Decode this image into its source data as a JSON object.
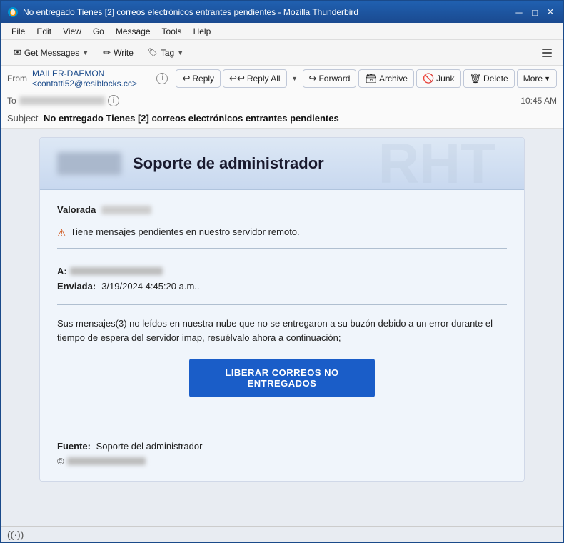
{
  "window": {
    "title": "No entregado Tienes [2] correos electrónicos entrantes pendientes - Mozilla Thunderbird",
    "title_short": "No entregado Tienes [2] correos electrónicos entrantes pendientes - Mozilla Thunderbird"
  },
  "menu": {
    "items": [
      "File",
      "Edit",
      "View",
      "Go",
      "Message",
      "Tools",
      "Help"
    ]
  },
  "toolbar": {
    "get_messages": "Get Messages",
    "write": "Write",
    "tag": "Tag",
    "hamburger_label": "≡"
  },
  "email_header": {
    "from_label": "From",
    "from_value": "MAILER-DAEMON <contatti52@resiblocks.cc>",
    "reply_label": "Reply",
    "reply_all_label": "Reply All",
    "forward_label": "Forward",
    "archive_label": "Archive",
    "junk_label": "Junk",
    "delete_label": "Delete",
    "more_label": "More",
    "to_label": "To",
    "time_value": "10:45 AM",
    "subject_label": "Subject",
    "subject_value": "No entregado Tienes [2] correos electrónicos entrantes pendientes"
  },
  "email_body": {
    "header_title": "Soporte de administrador",
    "valorada_label": "Valorada",
    "warning_text": "Tiene mensajes pendientes en nuestro servidor remoto.",
    "to_label": "A:",
    "sent_label": "Enviada:",
    "sent_value": "3/19/2024 4:45:20 a.m..",
    "main_text": "Sus mensajes(3) no leídos en nuestra nube que no se entregaron a su buzón debido a un error durante el tiempo de espera del servidor imap, resuélvalo ahora a continuación;",
    "cta_button": "LIBERAR CORREOS NO ENTREGADOS",
    "footer_source_label": "Fuente:",
    "footer_source_value": "Soporte del administrador"
  },
  "status_bar": {
    "wifi_icon": "((·))"
  }
}
